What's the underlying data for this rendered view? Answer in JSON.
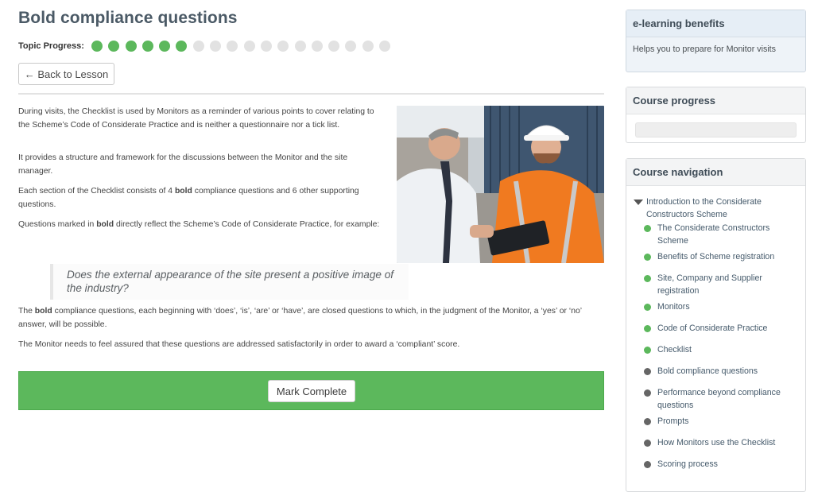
{
  "title": "Bold compliance questions",
  "progress": {
    "label": "Topic Progress:",
    "completed": 6,
    "total": 18
  },
  "back_button": "← Back to Lesson",
  "content": {
    "p1": "During visits, the Checklist is used by Monitors as a reminder of various points to cover relating to the Scheme’s Code of Considerate Practice and is neither a questionnaire nor a tick list.",
    "p2": "It provides a structure and framework for the discussions between the Monitor and the site manager.",
    "p3_pre": "Each section of the Checklist consists of 4 ",
    "p3_bold": "bold",
    "p3_post": " compliance questions and 6 other supporting questions.",
    "p4_pre": "Questions marked in ",
    "p4_bold": "bold",
    "p4_post": " directly reflect the Scheme’s Code of Considerate Practice, for example:",
    "quote": "Does the external appearance of the site present a positive image of the industry?",
    "p5_pre": "The ",
    "p5_bold": "bold",
    "p5_post": " compliance questions, each beginning with ‘does’, ‘is’, ‘are’ or ‘have’, are closed questions to which, in the judgment of the Monitor, a ‘yes’ or ‘no’ answer, will be possible.",
    "p6": "The Monitor needs to feel assured that these questions are addressed satisfactorily in order to award a ‘compliant’ score."
  },
  "mark_complete": "Mark Complete",
  "sidebar": {
    "benefits_title": "e-learning benefits",
    "benefits_text": "Helps you to prepare for Monitor visits",
    "course_progress_title": "Course progress",
    "course_progress_value": 0,
    "navigation_title": "Course navigation",
    "parent": "Introduction to the Considerate Constructors Scheme",
    "items": [
      {
        "label": "The Considerate Constructors Scheme",
        "done": true
      },
      {
        "label": "Benefits of Scheme registration",
        "done": true
      },
      {
        "label": "Site, Company and Supplier registration",
        "done": true
      },
      {
        "label": "Monitors",
        "done": true
      },
      {
        "label": "Code of Considerate Practice",
        "done": true
      },
      {
        "label": "Checklist",
        "done": true
      },
      {
        "label": "Bold compliance questions",
        "done": false
      },
      {
        "label": "Performance beyond compliance questions",
        "done": false
      },
      {
        "label": "Prompts",
        "done": false
      },
      {
        "label": "How Monitors use the Checklist",
        "done": false
      },
      {
        "label": "Scoring process",
        "done": false
      }
    ]
  },
  "colors": {
    "accent": "#5cb85c",
    "pending_dot": "#e2e2e2",
    "title": "#4b5a66"
  }
}
